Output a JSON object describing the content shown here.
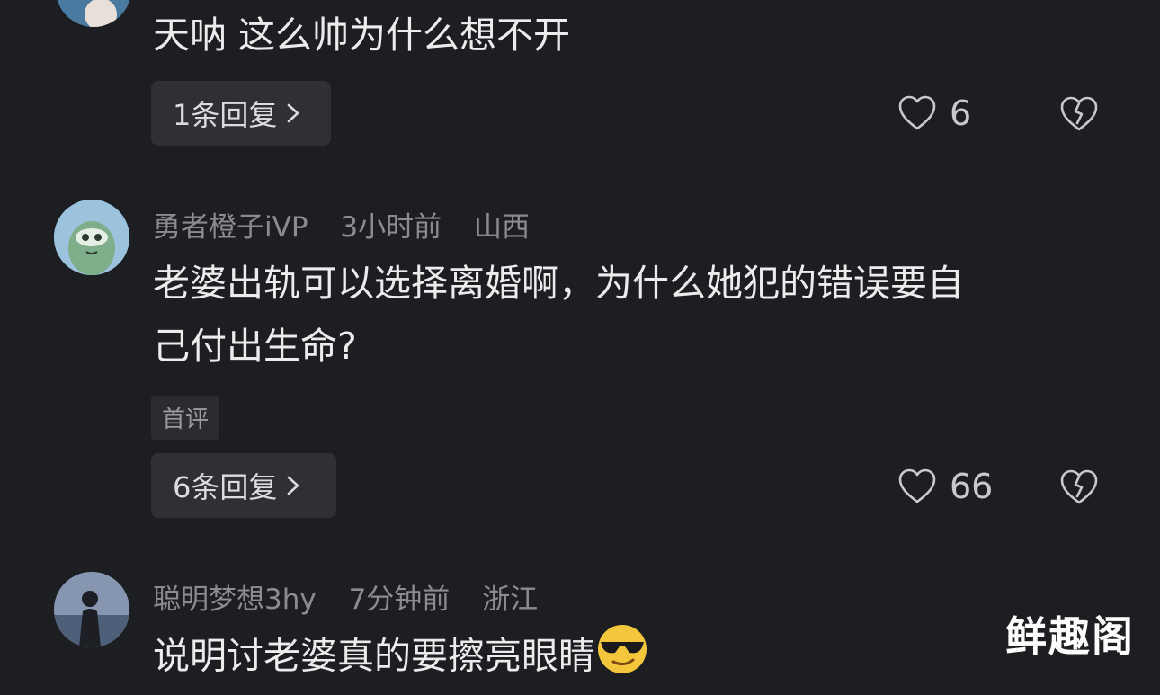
{
  "comments": [
    {
      "text": "天呐 这么帅为什么想不开",
      "reply_label": "1条回复",
      "likes": "6"
    },
    {
      "username": "勇者橙子iVP",
      "time": "3小时前",
      "location": "山西",
      "text_line1": "老婆出轨可以选择离婚啊，为什么她犯的错误要自",
      "text_line2": "己付出生命?",
      "badge": "首评",
      "reply_label": "6条回复",
      "likes": "66"
    },
    {
      "username": "聪明梦想3hy",
      "time": "7分钟前",
      "location": "浙江",
      "text": "说明讨老婆真的要擦亮眼睛"
    }
  ],
  "watermark": "鲜趣阁",
  "icons": {
    "like": "heart-outline-icon",
    "dislike": "broken-heart-icon",
    "chevron": "chevron-right-icon",
    "emoji": "cool-sunglasses-emoji"
  },
  "colors": {
    "background": "#1c1e21",
    "text": "#ececed",
    "meta": "#8b8c8f",
    "button_bg": "#2e3034"
  }
}
